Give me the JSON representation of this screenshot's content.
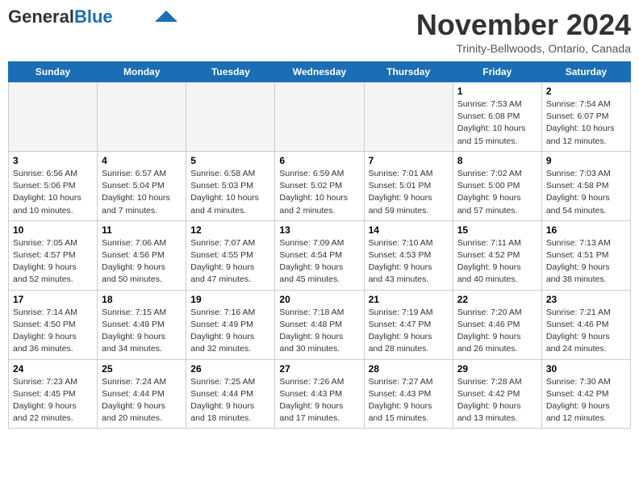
{
  "header": {
    "logo_general": "General",
    "logo_blue": "Blue",
    "month_title": "November 2024",
    "subtitle": "Trinity-Bellwoods, Ontario, Canada"
  },
  "weekdays": [
    "Sunday",
    "Monday",
    "Tuesday",
    "Wednesday",
    "Thursday",
    "Friday",
    "Saturday"
  ],
  "weeks": [
    [
      {
        "day": "",
        "text": ""
      },
      {
        "day": "",
        "text": ""
      },
      {
        "day": "",
        "text": ""
      },
      {
        "day": "",
        "text": ""
      },
      {
        "day": "",
        "text": ""
      },
      {
        "day": "1",
        "text": "Sunrise: 7:53 AM\nSunset: 6:08 PM\nDaylight: 10 hours and 15 minutes."
      },
      {
        "day": "2",
        "text": "Sunrise: 7:54 AM\nSunset: 6:07 PM\nDaylight: 10 hours and 12 minutes."
      }
    ],
    [
      {
        "day": "3",
        "text": "Sunrise: 6:56 AM\nSunset: 5:06 PM\nDaylight: 10 hours and 10 minutes."
      },
      {
        "day": "4",
        "text": "Sunrise: 6:57 AM\nSunset: 5:04 PM\nDaylight: 10 hours and 7 minutes."
      },
      {
        "day": "5",
        "text": "Sunrise: 6:58 AM\nSunset: 5:03 PM\nDaylight: 10 hours and 4 minutes."
      },
      {
        "day": "6",
        "text": "Sunrise: 6:59 AM\nSunset: 5:02 PM\nDaylight: 10 hours and 2 minutes."
      },
      {
        "day": "7",
        "text": "Sunrise: 7:01 AM\nSunset: 5:01 PM\nDaylight: 9 hours and 59 minutes."
      },
      {
        "day": "8",
        "text": "Sunrise: 7:02 AM\nSunset: 5:00 PM\nDaylight: 9 hours and 57 minutes."
      },
      {
        "day": "9",
        "text": "Sunrise: 7:03 AM\nSunset: 4:58 PM\nDaylight: 9 hours and 54 minutes."
      }
    ],
    [
      {
        "day": "10",
        "text": "Sunrise: 7:05 AM\nSunset: 4:57 PM\nDaylight: 9 hours and 52 minutes."
      },
      {
        "day": "11",
        "text": "Sunrise: 7:06 AM\nSunset: 4:56 PM\nDaylight: 9 hours and 50 minutes."
      },
      {
        "day": "12",
        "text": "Sunrise: 7:07 AM\nSunset: 4:55 PM\nDaylight: 9 hours and 47 minutes."
      },
      {
        "day": "13",
        "text": "Sunrise: 7:09 AM\nSunset: 4:54 PM\nDaylight: 9 hours and 45 minutes."
      },
      {
        "day": "14",
        "text": "Sunrise: 7:10 AM\nSunset: 4:53 PM\nDaylight: 9 hours and 43 minutes."
      },
      {
        "day": "15",
        "text": "Sunrise: 7:11 AM\nSunset: 4:52 PM\nDaylight: 9 hours and 40 minutes."
      },
      {
        "day": "16",
        "text": "Sunrise: 7:13 AM\nSunset: 4:51 PM\nDaylight: 9 hours and 38 minutes."
      }
    ],
    [
      {
        "day": "17",
        "text": "Sunrise: 7:14 AM\nSunset: 4:50 PM\nDaylight: 9 hours and 36 minutes."
      },
      {
        "day": "18",
        "text": "Sunrise: 7:15 AM\nSunset: 4:49 PM\nDaylight: 9 hours and 34 minutes."
      },
      {
        "day": "19",
        "text": "Sunrise: 7:16 AM\nSunset: 4:49 PM\nDaylight: 9 hours and 32 minutes."
      },
      {
        "day": "20",
        "text": "Sunrise: 7:18 AM\nSunset: 4:48 PM\nDaylight: 9 hours and 30 minutes."
      },
      {
        "day": "21",
        "text": "Sunrise: 7:19 AM\nSunset: 4:47 PM\nDaylight: 9 hours and 28 minutes."
      },
      {
        "day": "22",
        "text": "Sunrise: 7:20 AM\nSunset: 4:46 PM\nDaylight: 9 hours and 26 minutes."
      },
      {
        "day": "23",
        "text": "Sunrise: 7:21 AM\nSunset: 4:46 PM\nDaylight: 9 hours and 24 minutes."
      }
    ],
    [
      {
        "day": "24",
        "text": "Sunrise: 7:23 AM\nSunset: 4:45 PM\nDaylight: 9 hours and 22 minutes."
      },
      {
        "day": "25",
        "text": "Sunrise: 7:24 AM\nSunset: 4:44 PM\nDaylight: 9 hours and 20 minutes."
      },
      {
        "day": "26",
        "text": "Sunrise: 7:25 AM\nSunset: 4:44 PM\nDaylight: 9 hours and 18 minutes."
      },
      {
        "day": "27",
        "text": "Sunrise: 7:26 AM\nSunset: 4:43 PM\nDaylight: 9 hours and 17 minutes."
      },
      {
        "day": "28",
        "text": "Sunrise: 7:27 AM\nSunset: 4:43 PM\nDaylight: 9 hours and 15 minutes."
      },
      {
        "day": "29",
        "text": "Sunrise: 7:28 AM\nSunset: 4:42 PM\nDaylight: 9 hours and 13 minutes."
      },
      {
        "day": "30",
        "text": "Sunrise: 7:30 AM\nSunset: 4:42 PM\nDaylight: 9 hours and 12 minutes."
      }
    ]
  ]
}
